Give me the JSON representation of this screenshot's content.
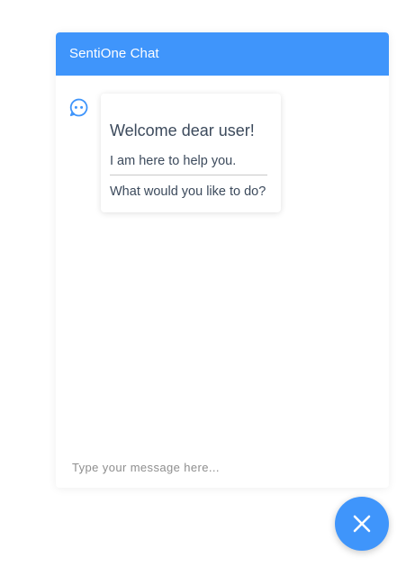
{
  "header": {
    "title": "SentiOne Chat"
  },
  "message": {
    "title": "Welcome dear user!",
    "line1": "I am here to help you.",
    "line2": "What would you like to do?"
  },
  "input": {
    "placeholder": "Type your message here..."
  },
  "icons": {
    "bot_avatar": "chat-bubble-icon",
    "close": "close-icon"
  },
  "colors": {
    "accent": "#3f95fb",
    "text": "#3c4a5c",
    "placeholder": "#8e8e8e"
  }
}
